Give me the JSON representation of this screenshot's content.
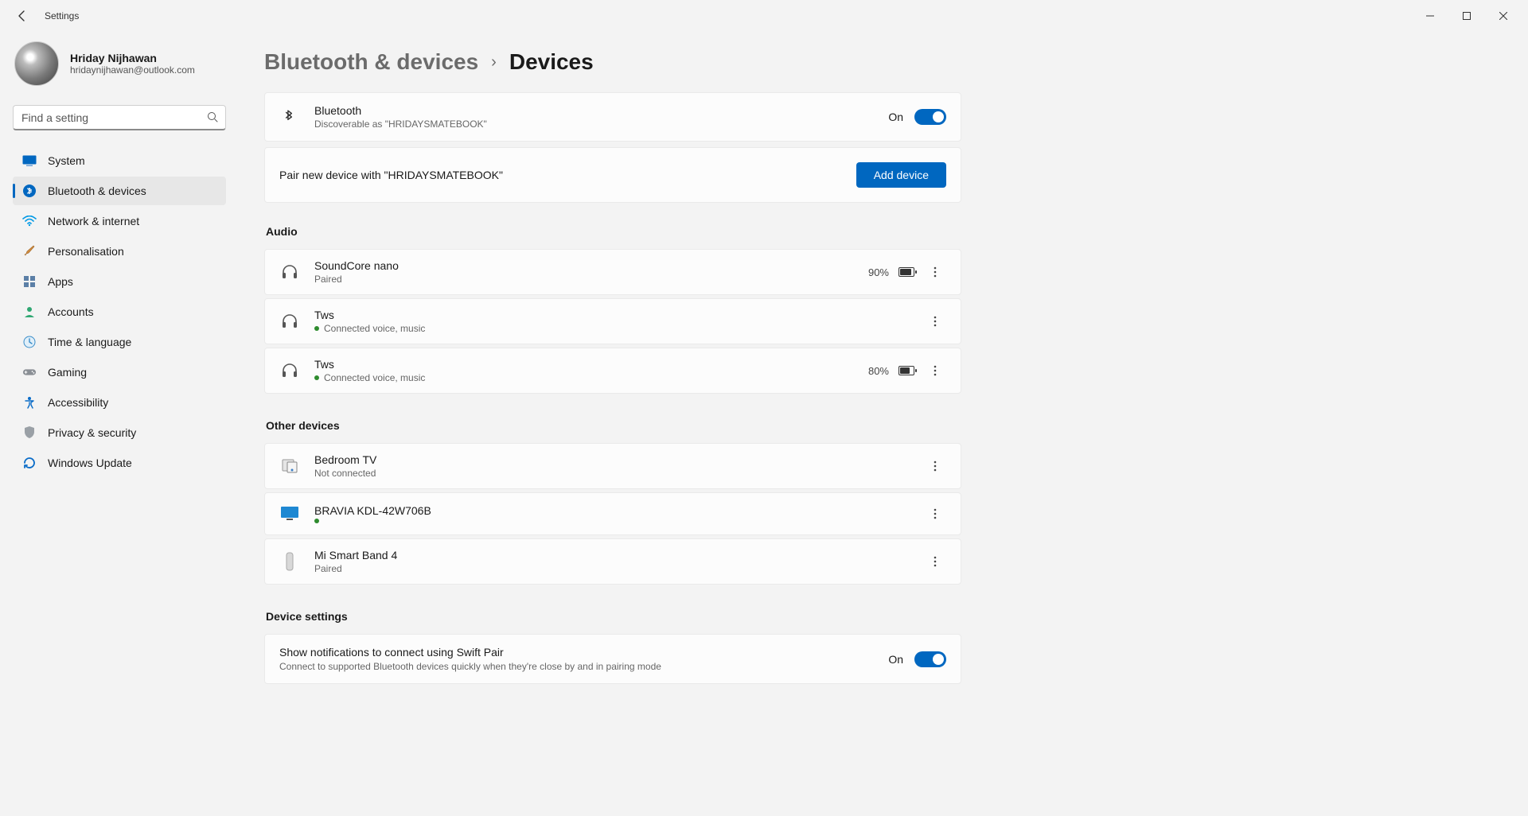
{
  "titlebar": {
    "app": "Settings"
  },
  "profile": {
    "name": "Hriday Nijhawan",
    "email": "hridaynijhawan@outlook.com"
  },
  "search": {
    "placeholder": "Find a setting"
  },
  "nav": [
    {
      "label": "System",
      "icon": "system"
    },
    {
      "label": "Bluetooth & devices",
      "icon": "bluetooth",
      "selected": true
    },
    {
      "label": "Network & internet",
      "icon": "wifi"
    },
    {
      "label": "Personalisation",
      "icon": "brush"
    },
    {
      "label": "Apps",
      "icon": "apps"
    },
    {
      "label": "Accounts",
      "icon": "account"
    },
    {
      "label": "Time & language",
      "icon": "time"
    },
    {
      "label": "Gaming",
      "icon": "gaming"
    },
    {
      "label": "Accessibility",
      "icon": "accessibility"
    },
    {
      "label": "Privacy & security",
      "icon": "privacy"
    },
    {
      "label": "Windows Update",
      "icon": "update"
    }
  ],
  "breadcrumb": {
    "parent": "Bluetooth & devices",
    "current": "Devices"
  },
  "bluetooth": {
    "title": "Bluetooth",
    "subtitle": "Discoverable as \"HRIDAYSMATEBOOK\"",
    "state_label": "On"
  },
  "pair": {
    "text": "Pair new device with \"HRIDAYSMATEBOOK\"",
    "button": "Add device"
  },
  "sections": {
    "audio": "Audio",
    "other": "Other devices",
    "settings": "Device settings"
  },
  "audio_devices": [
    {
      "name": "SoundCore nano",
      "status": "Paired",
      "connected": false,
      "battery": "90%",
      "fill": 90
    },
    {
      "name": "Tws",
      "status": "Connected voice, music",
      "connected": true,
      "battery": null
    },
    {
      "name": "Tws",
      "status": "Connected voice, music",
      "connected": true,
      "battery": "80%",
      "fill": 80
    }
  ],
  "other_devices": [
    {
      "name": "Bedroom TV",
      "status": "Not connected",
      "connected": false,
      "icon": "device"
    },
    {
      "name": "BRAVIA KDL-42W706B",
      "status": "",
      "connected": true,
      "icon": "monitor"
    },
    {
      "name": "Mi Smart Band 4",
      "status": "Paired",
      "connected": false,
      "icon": "band"
    }
  ],
  "swift": {
    "title": "Show notifications to connect using Swift Pair",
    "subtitle": "Connect to supported Bluetooth devices quickly when they're close by and in pairing mode",
    "state_label": "On"
  }
}
